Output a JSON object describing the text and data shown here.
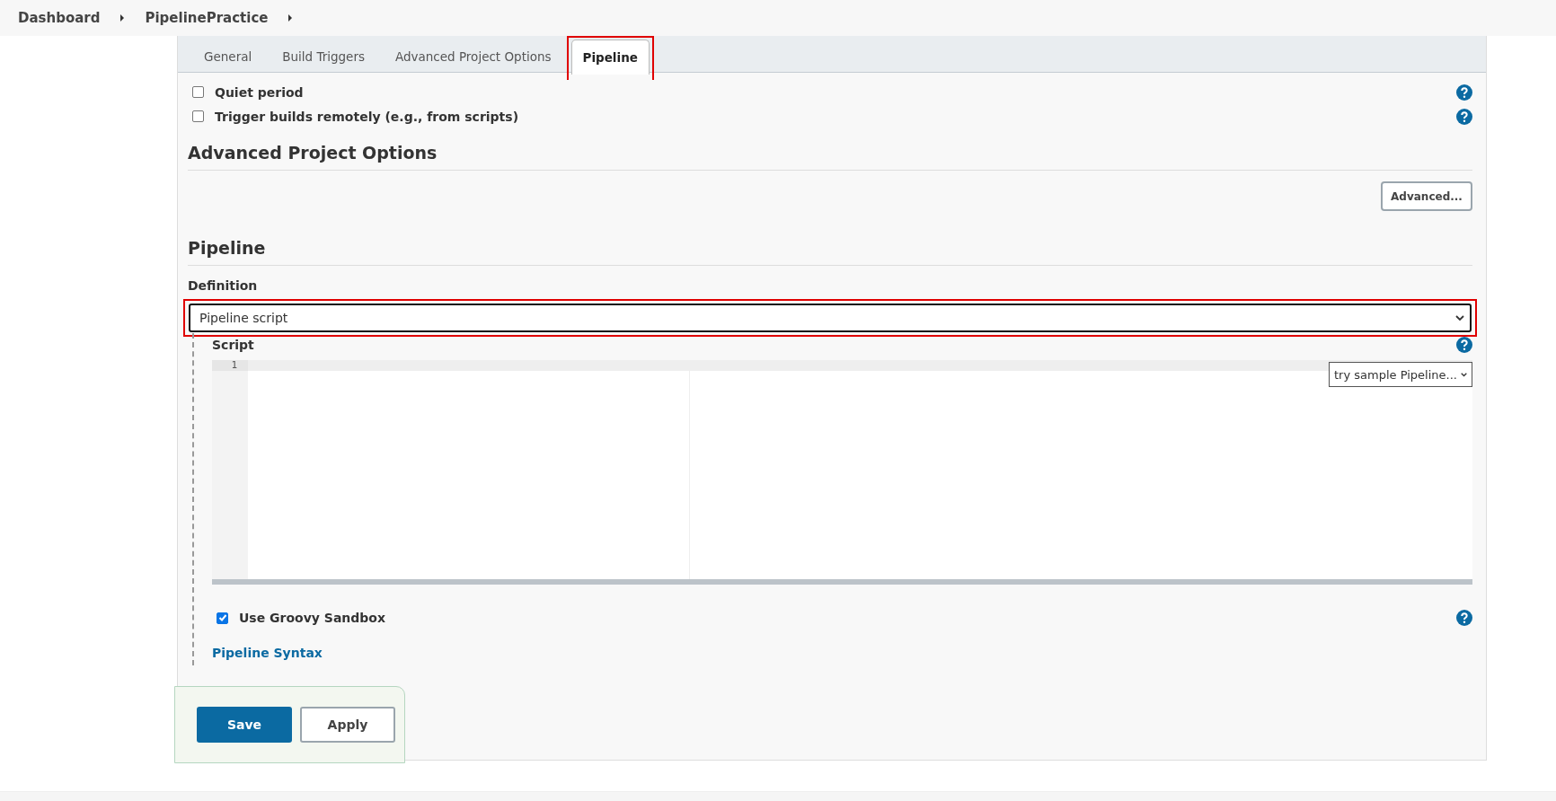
{
  "breadcrumbs": [
    "Dashboard",
    "PipelinePractice"
  ],
  "tabs": [
    {
      "label": "General",
      "selected": false,
      "highlighted": false
    },
    {
      "label": "Build Triggers",
      "selected": false,
      "highlighted": false
    },
    {
      "label": "Advanced Project Options",
      "selected": false,
      "highlighted": false
    },
    {
      "label": "Pipeline",
      "selected": true,
      "highlighted": true
    }
  ],
  "build_triggers": [
    {
      "label": "Quiet period",
      "checked": false
    },
    {
      "label": "Trigger builds remotely (e.g., from scripts)",
      "checked": false
    }
  ],
  "advanced_section": {
    "heading": "Advanced Project Options",
    "button": "Advanced..."
  },
  "pipeline_section": {
    "heading": "Pipeline",
    "definition_label": "Definition",
    "definition_value": "Pipeline script",
    "definition_highlighted": true,
    "script_label": "Script",
    "line_numbers": [
      "1"
    ],
    "sample_select": "try sample Pipeline...",
    "sandbox": {
      "label": "Use Groovy Sandbox",
      "checked": true
    },
    "syntax_link": "Pipeline Syntax"
  },
  "buttons": [
    {
      "label": "Save",
      "kind": "primary"
    },
    {
      "label": "Apply",
      "kind": "secondary"
    }
  ]
}
